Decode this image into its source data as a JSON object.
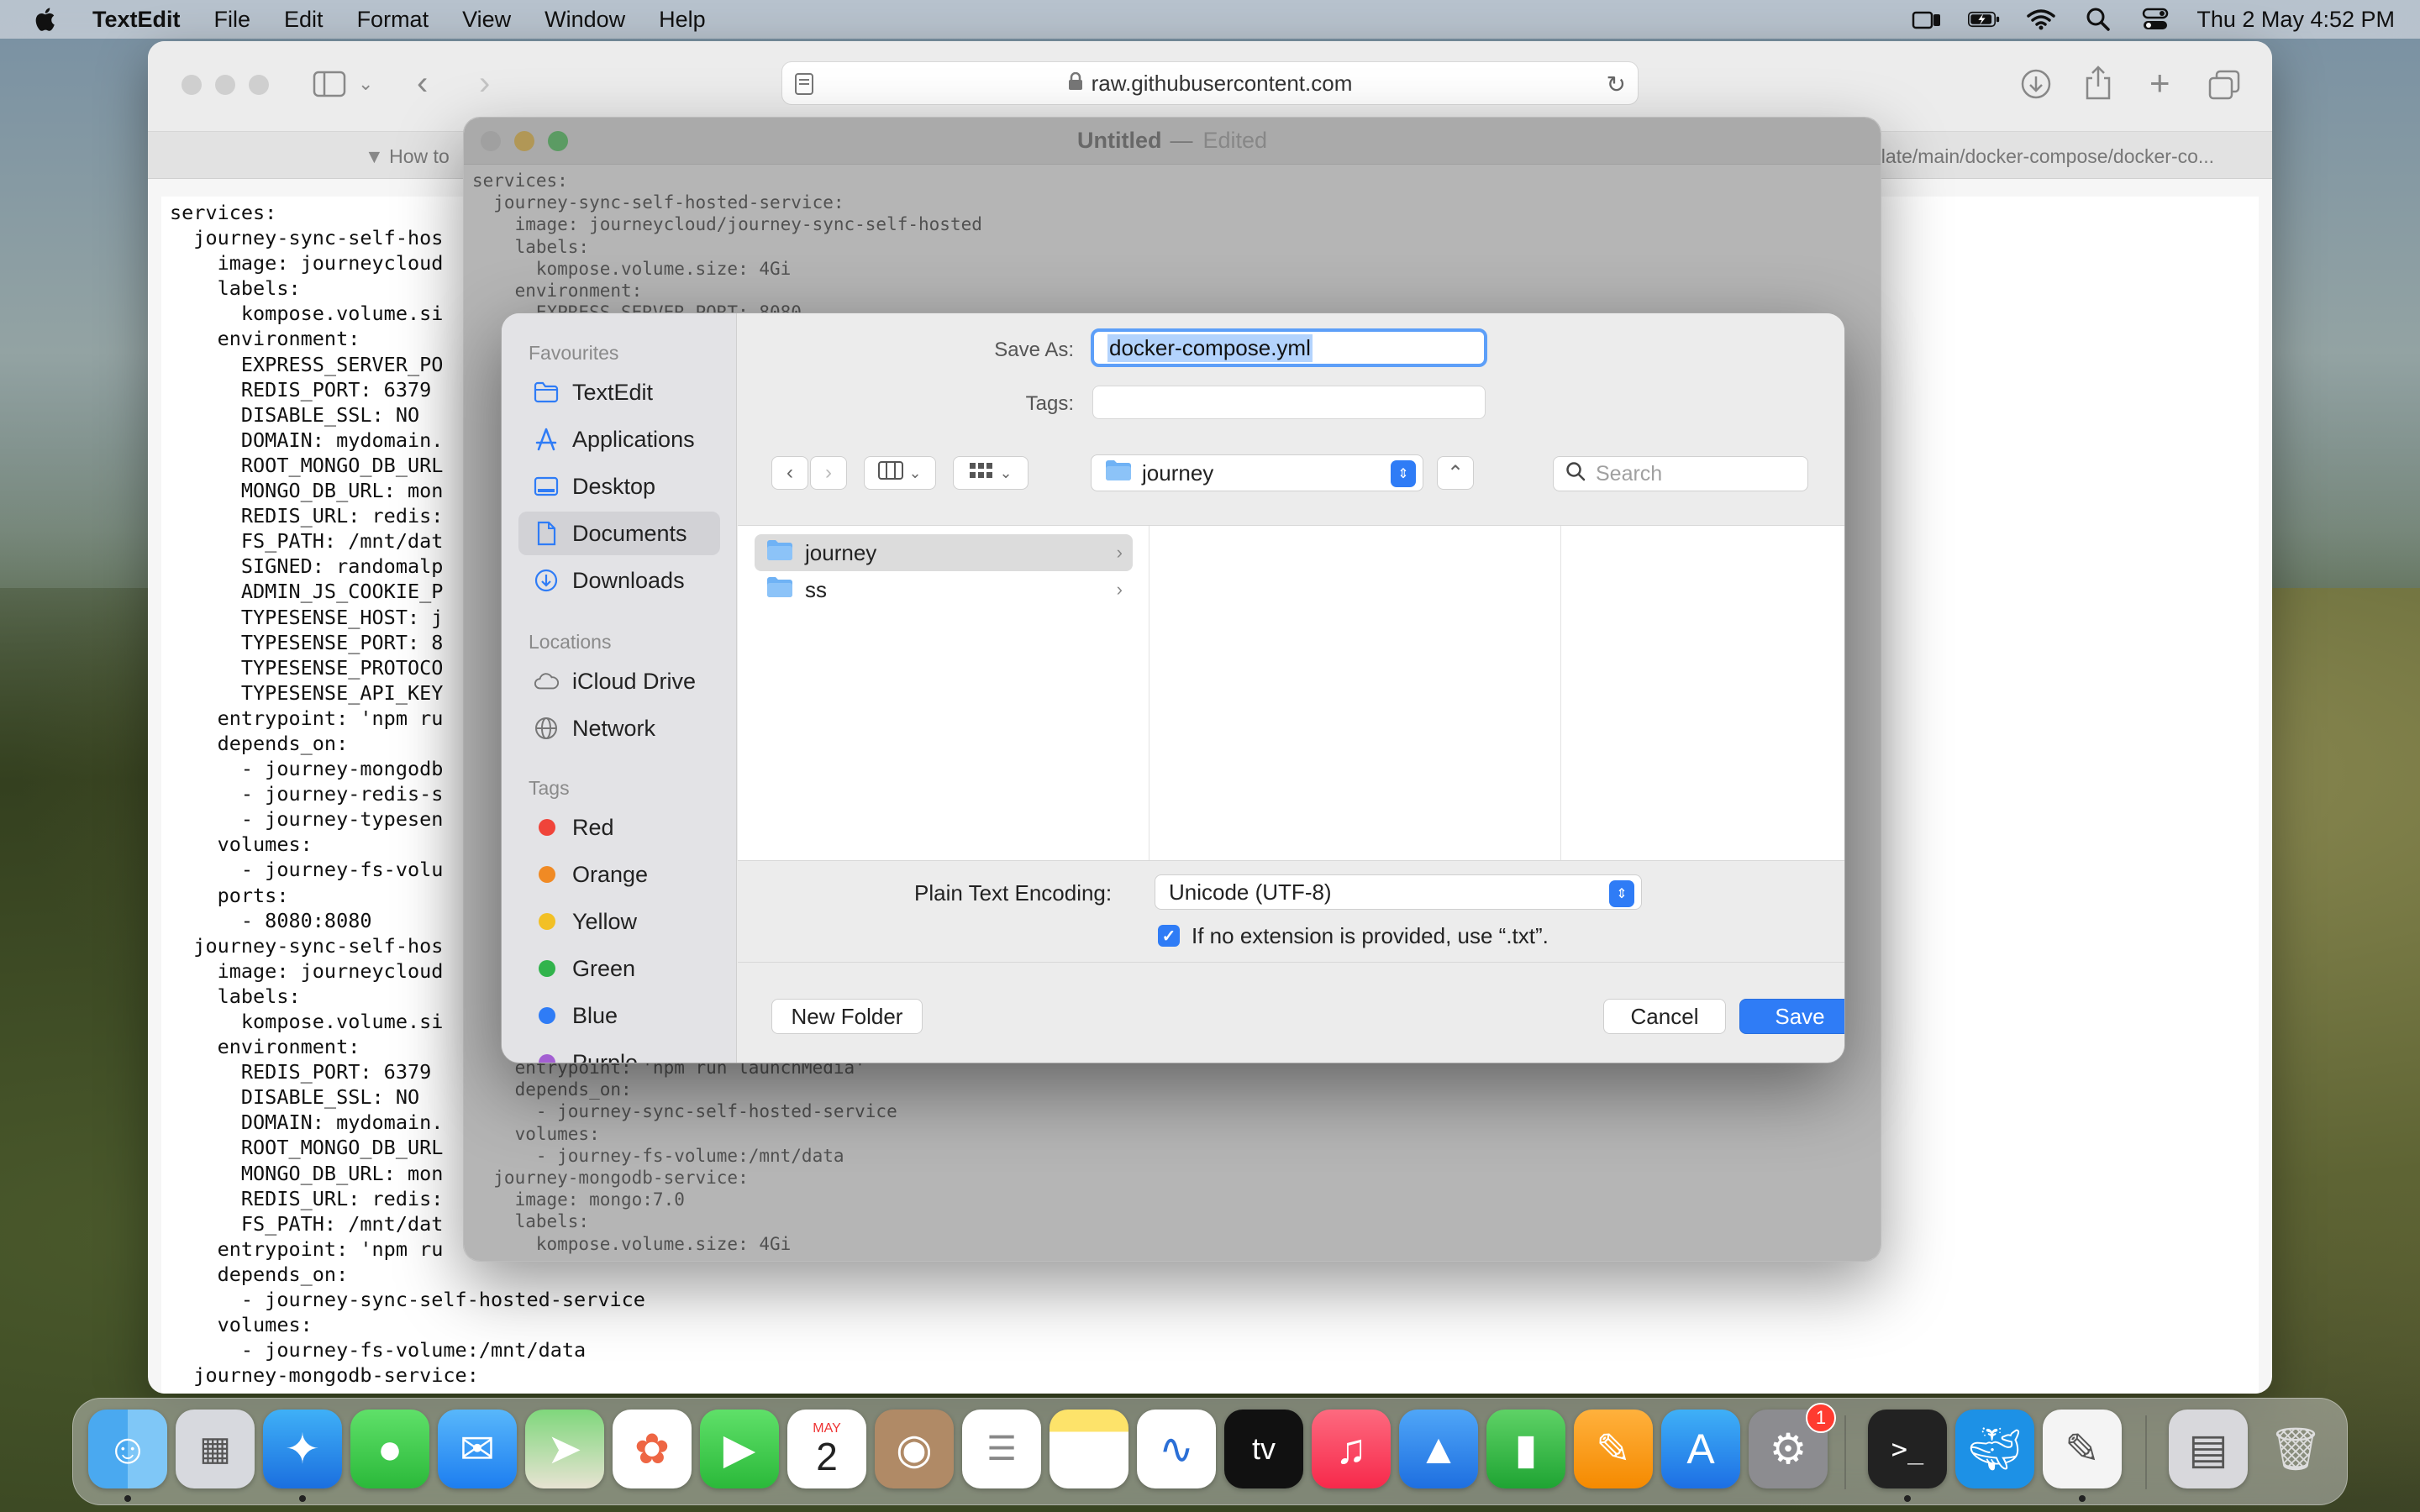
{
  "menubar": {
    "app_name": "TextEdit",
    "menus": [
      "File",
      "Edit",
      "Format",
      "View",
      "Window",
      "Help"
    ],
    "clock": "Thu 2 May  4:52 PM"
  },
  "safari": {
    "address": "raw.githubusercontent.com",
    "tab_left": "How to",
    "tab_right": "plate/main/docker-compose/docker-co...",
    "code": "services:\n  journey-sync-self-hos\n    image: journeycloud\n    labels:\n      kompose.volume.si\n    environment:\n      EXPRESS_SERVER_PO\n      REDIS_PORT: 6379\n      DISABLE_SSL: NO\n      DOMAIN: mydomain.\n      ROOT_MONGO_DB_URL\n      MONGO_DB_URL: mon\n      REDIS_URL: redis:\n      FS_PATH: /mnt/dat\n      SIGNED: randomalp\n      ADMIN_JS_COOKIE_P\n      TYPESENSE_HOST: j\n      TYPESENSE_PORT: 8\n      TYPESENSE_PROTOCO\n      TYPESENSE_API_KEY\n    entrypoint: 'npm ru\n    depends_on:\n      - journey-mongodb\n      - journey-redis-s\n      - journey-typesen\n    volumes:\n      - journey-fs-volu\n    ports:\n      - 8080:8080\n  journey-sync-self-hos\n    image: journeycloud\n    labels:\n      kompose.volume.si\n    environment:\n      REDIS_PORT: 6379\n      DISABLE_SSL: NO\n      DOMAIN: mydomain.\n      ROOT_MONGO_DB_URL\n      MONGO_DB_URL: mon\n      REDIS_URL: redis:\n      FS_PATH: /mnt/dat\n    entrypoint: 'npm ru\n    depends_on:\n      - journey-sync-self-hosted-service\n    volumes:\n      - journey-fs-volume:/mnt/data\n  journey-mongodb-service:"
  },
  "textedit": {
    "title": "Untitled",
    "dash": "—",
    "status": "Edited",
    "code_top": "services:\n  journey-sync-self-hosted-service:\n    image: journeycloud/journey-sync-self-hosted\n    labels:\n      kompose.volume.size: 4Gi\n    environment:\n      EXPRESS_SERVER_PORT: 8080",
    "code_bottom": "    entrypoint: 'npm run launchMedia'\n    depends_on:\n      - journey-sync-self-hosted-service\n    volumes:\n      - journey-fs-volume:/mnt/data\n  journey-mongodb-service:\n    image: mongo:7.0\n    labels:\n      kompose.volume.size: 4Gi"
  },
  "dialog": {
    "sidebar": {
      "favourites_label": "Favourites",
      "favourites": [
        {
          "label": "TextEdit",
          "icon": "folder-icon"
        },
        {
          "label": "Applications",
          "icon": "applications-icon"
        },
        {
          "label": "Desktop",
          "icon": "desktop-icon"
        },
        {
          "label": "Documents",
          "icon": "document-icon"
        },
        {
          "label": "Downloads",
          "icon": "download-icon"
        }
      ],
      "locations_label": "Locations",
      "locations": [
        {
          "label": "iCloud Drive",
          "icon": "cloud-icon"
        },
        {
          "label": "Network",
          "icon": "globe-icon"
        }
      ],
      "tags_label": "Tags",
      "tags": [
        {
          "label": "Red",
          "color": "#f0443a"
        },
        {
          "label": "Orange",
          "color": "#f08a24"
        },
        {
          "label": "Yellow",
          "color": "#f2c025"
        },
        {
          "label": "Green",
          "color": "#31b34c"
        },
        {
          "label": "Blue",
          "color": "#2f7cf6"
        },
        {
          "label": "Purple",
          "color": "#a35fd2"
        }
      ]
    },
    "save_as_label": "Save As:",
    "save_as_value": "docker-compose.yml",
    "tags_label": "Tags:",
    "location": "journey",
    "search_placeholder": "Search",
    "files": [
      {
        "name": "journey"
      },
      {
        "name": "ss"
      }
    ],
    "encoding_label": "Plain Text Encoding:",
    "encoding_value": "Unicode (UTF-8)",
    "extension_checkbox_label": "If no extension is provided, use “.txt”.",
    "extension_checked": true,
    "new_folder_label": "New Folder",
    "cancel_label": "Cancel",
    "save_label": "Save"
  },
  "dock": {
    "calendar_month": "MAY",
    "calendar_day": "2",
    "settings_badge": "1",
    "tv_label": "tv"
  },
  "colors": {
    "accent": "#2f7cf6",
    "selection": "#b3d3fd"
  }
}
